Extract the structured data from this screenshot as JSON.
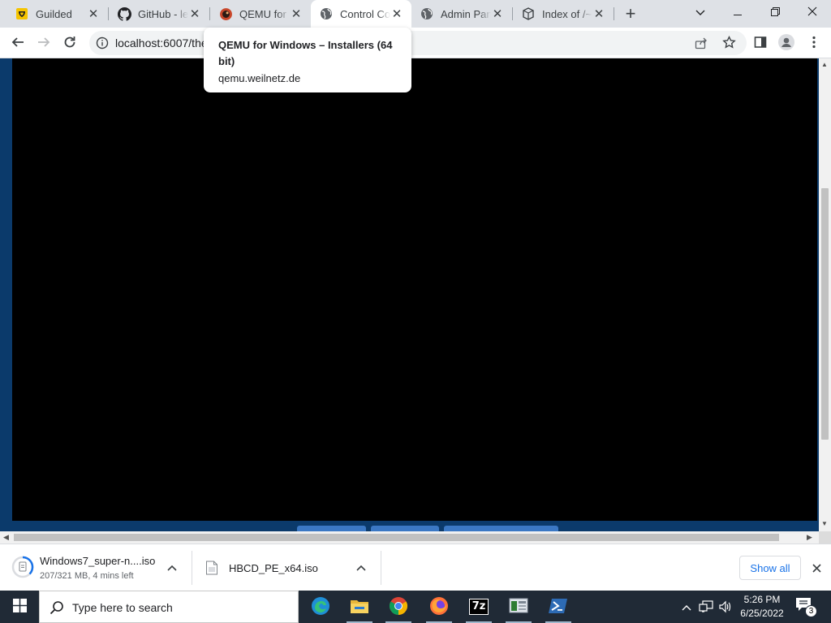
{
  "browser": {
    "tabs": [
      {
        "title": "Guilded",
        "icon": "guilded-icon",
        "active": false
      },
      {
        "title": "GitHub - le",
        "icon": "github-icon",
        "active": false
      },
      {
        "title": "QEMU for W",
        "icon": "qemu-icon",
        "active": false
      },
      {
        "title": "Control Co",
        "icon": "globe-icon",
        "active": true
      },
      {
        "title": "Admin Pan",
        "icon": "globe-icon",
        "active": false
      },
      {
        "title": "Index of /~",
        "icon": "index-icon",
        "active": false
      }
    ],
    "new_tab_label": "+",
    "url": "localhost:6007/the",
    "tooltip": {
      "title": "QEMU for Windows – Installers (64 bit)",
      "domain": "qemu.weilnetz.de"
    }
  },
  "downloads": {
    "items": [
      {
        "name": "Windows7_super-n....iso",
        "status": "207/321 MB, 4 mins left"
      },
      {
        "name": "HBCD_PE_x64.iso",
        "status": ""
      }
    ],
    "show_all_label": "Show all"
  },
  "taskbar": {
    "search_placeholder": "Type here to search",
    "time": "5:26 PM",
    "date": "6/25/2022",
    "notification_count": "3",
    "apps": [
      "edge-icon",
      "file-explorer-icon",
      "chrome-icon",
      "firefox-icon",
      "7zip-icon",
      "vm-app-icon",
      "powershell-icon"
    ],
    "labels": {
      "seven_zip": "7z"
    }
  },
  "colors": {
    "page_background": "#0b3a6b",
    "vm_screen": "#000000",
    "accent": "#1a73e8",
    "taskbar": "#202a36"
  }
}
